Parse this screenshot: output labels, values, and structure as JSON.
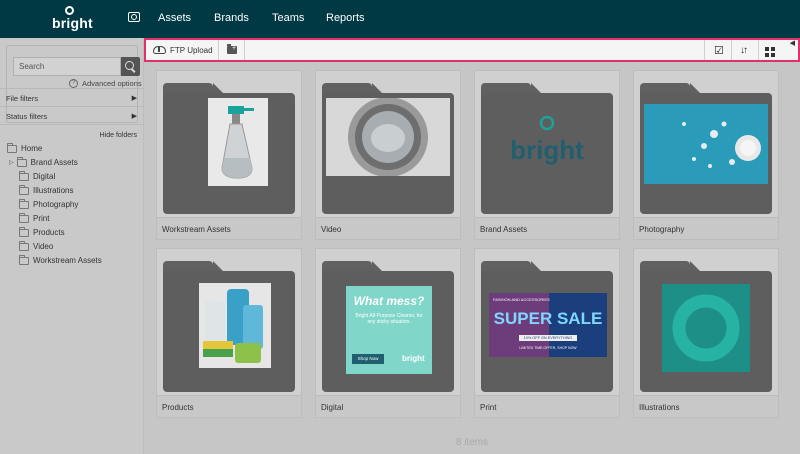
{
  "app": {
    "brand": "bright"
  },
  "nav": {
    "items": [
      "Assets",
      "Brands",
      "Teams",
      "Reports"
    ]
  },
  "sidebar": {
    "search": {
      "placeholder": "Search",
      "advanced_label": "Advanced options"
    },
    "filters": [
      {
        "label": "File filters"
      },
      {
        "label": "Status filters"
      }
    ],
    "hide_folders_label": "Hide folders",
    "tree": {
      "root": "Home",
      "children": [
        "Brand Assets",
        "Digital",
        "Illustrations",
        "Photography",
        "Print",
        "Products",
        "Video",
        "Workstream Assets"
      ]
    }
  },
  "toolbar": {
    "ftp_label": "FTP Upload"
  },
  "folders": [
    {
      "label": "Workstream Assets",
      "thumb": "spray-bottle"
    },
    {
      "label": "Video",
      "thumb": "washing-machine"
    },
    {
      "label": "Brand Assets",
      "thumb": "bright-logo",
      "logo_text": "bright"
    },
    {
      "label": "Photography",
      "thumb": "splash"
    },
    {
      "label": "Products",
      "thumb": "cleaning-products"
    },
    {
      "label": "Digital",
      "thumb": "ad-banner",
      "ad_title": "What mess?",
      "ad_body": "Bright All-Purpose Cleaner, for any sticky situation.",
      "ad_button": "Shop Now",
      "ad_logo": "bright"
    },
    {
      "label": "Print",
      "thumb": "sale-banner",
      "sale_top": "FASHION AND ACCESSORIES",
      "sale_title": "SUPER SALE",
      "sale_sub": "10% OFF ON EVERYTHING",
      "sale_bottom": "LIMITED TIME OFFER, SHOP NOW"
    },
    {
      "label": "Illustrations",
      "thumb": "green-ring"
    }
  ],
  "footer": {
    "count_label": "8 items"
  },
  "colors": {
    "nav_bg": "#003844",
    "highlight": "#e0306e",
    "brand_teal": "#1aa39a"
  }
}
